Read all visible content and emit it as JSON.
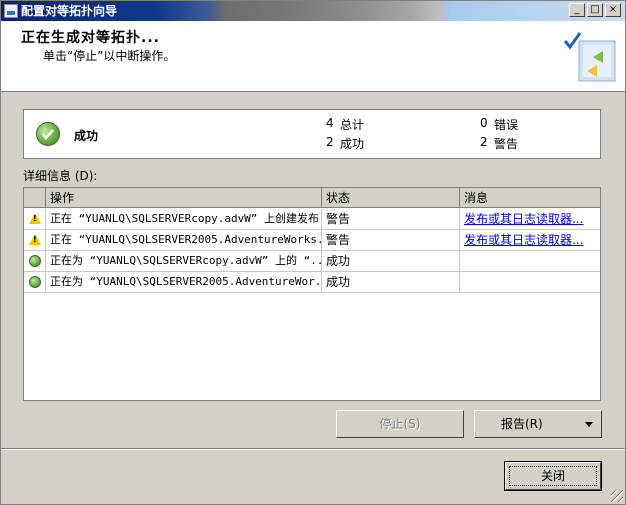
{
  "window": {
    "title": "配置对等拓扑向导",
    "controls": {
      "minimize": "_",
      "maximize": "□",
      "close": "×"
    }
  },
  "header": {
    "title": "正在生成对等拓扑...",
    "subtitle": "单击“停止”以中断操作。"
  },
  "summary": {
    "status": "成功",
    "total_count": "4",
    "total_label": "总计",
    "success_count": "2",
    "success_label": "成功",
    "error_count": "0",
    "error_label": "错误",
    "warning_count": "2",
    "warning_label": "警告"
  },
  "details": {
    "label": "详细信息 (D):",
    "columns": {
      "action": "操作",
      "status": "状态",
      "message": "消息"
    },
    "rows": [
      {
        "icon": "warning-icon",
        "action": "正在 “YUANLQ\\SQLSERVERcopy.advW” 上创建发布",
        "status": "警告",
        "message": "发布或其日志读取器..."
      },
      {
        "icon": "warning-icon",
        "action": "正在 “YUANLQ\\SQLSERVER2005.AdventureWorks...",
        "status": "警告",
        "message": "发布或其日志读取器..."
      },
      {
        "icon": "success-icon",
        "action": "正在为 “YUANLQ\\SQLSERVERcopy.advW” 上的 “...",
        "status": "成功",
        "message": ""
      },
      {
        "icon": "success-icon",
        "action": "正在为 “YUANLQ\\SQLSERVER2005.AdventureWor...",
        "status": "成功",
        "message": ""
      }
    ]
  },
  "buttons": {
    "stop": "停止(S)",
    "report": "报告(R)",
    "close": "关闭"
  },
  "colors": {
    "title_bar_start": "#0a246a",
    "link": "#0000ee",
    "success": "#6bb24a",
    "warning": "#f2c200"
  }
}
